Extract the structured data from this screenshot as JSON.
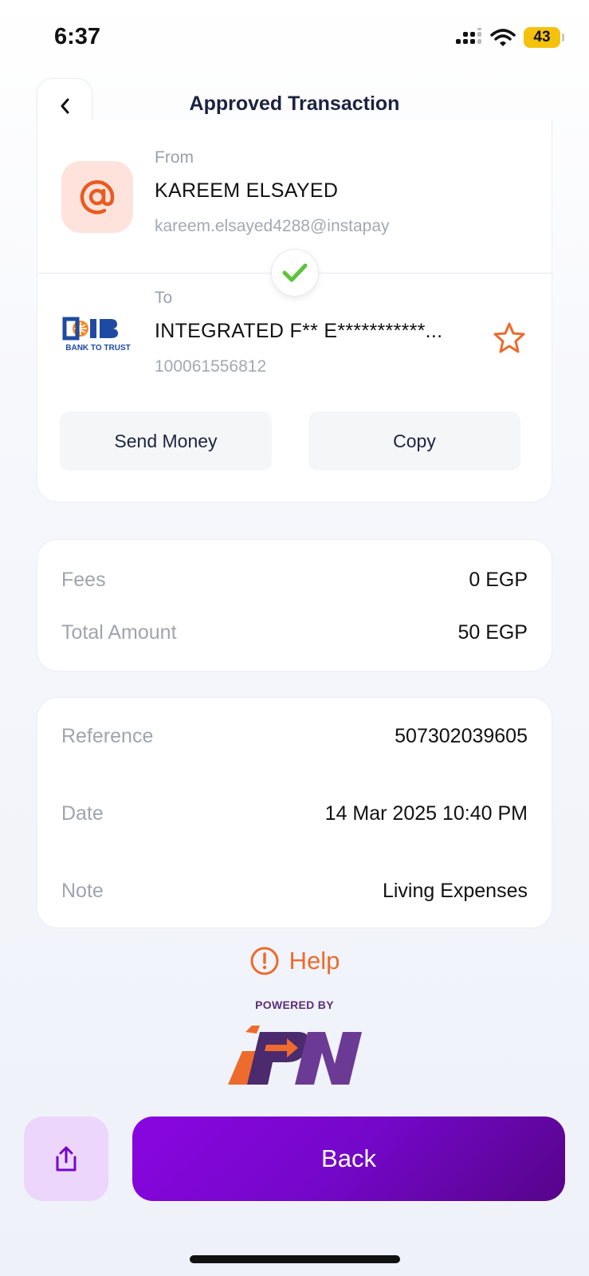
{
  "status": {
    "time": "6:37",
    "battery": "43"
  },
  "header": {
    "title": "Approved Transaction"
  },
  "from": {
    "label": "From",
    "name": "KAREEM ELSAYED",
    "address": "kareem.elsayed4288@instapay"
  },
  "to": {
    "label": "To",
    "name": "INTEGRATED F** E***********...",
    "account": "100061556812",
    "bank_tagline": "BANK TO TRUST"
  },
  "actions": {
    "send_money": "Send Money",
    "copy": "Copy"
  },
  "amounts": {
    "fees_label": "Fees",
    "fees_value": "0 EGP",
    "total_label": "Total Amount",
    "total_value": "50 EGP"
  },
  "details": {
    "reference_label": "Reference",
    "reference_value": "507302039605",
    "date_label": "Date",
    "date_value": "14 Mar 2025 10:40 PM",
    "note_label": "Note",
    "note_value": "Living Expenses"
  },
  "help": {
    "label": "Help"
  },
  "footer": {
    "powered_by": "POWERED BY"
  },
  "bottom": {
    "back_label": "Back"
  },
  "colors": {
    "accent": "#7407c9",
    "orange": "#ec6b2d",
    "success": "#5cc43a"
  }
}
